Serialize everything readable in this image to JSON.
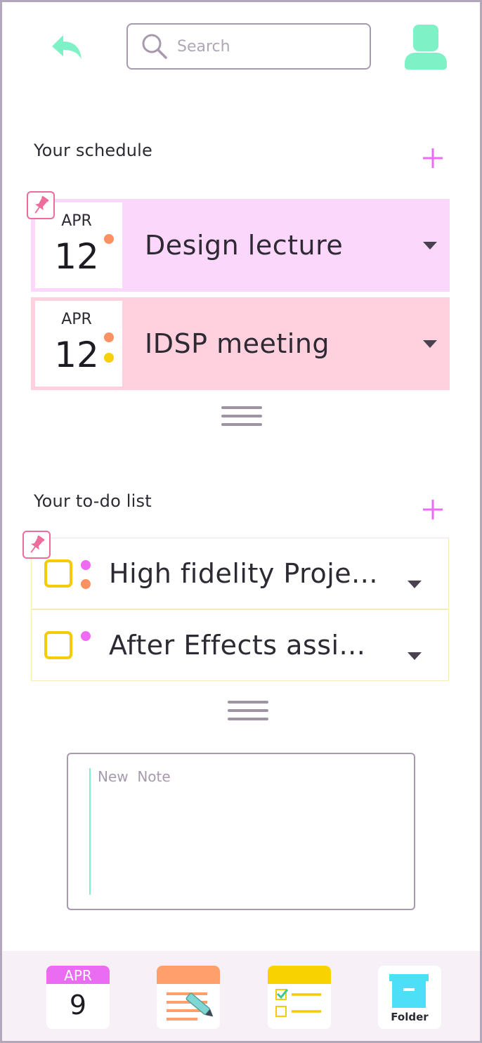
{
  "header": {
    "search_placeholder": "Search"
  },
  "schedule": {
    "title": "Your schedule",
    "items": [
      {
        "month": "APR",
        "day": "12",
        "title": "Design lecture",
        "bg": "#fbd7fb",
        "dots": [
          "#fa9162"
        ]
      },
      {
        "month": "APR",
        "day": "12",
        "title": "IDSP meeting",
        "bg": "#ffd1de",
        "dots": [
          "#fa9162",
          "#f6d10b"
        ]
      }
    ]
  },
  "todo": {
    "title": "Your to-do list",
    "items": [
      {
        "title": "High fidelity Proje...",
        "dots": [
          "#f06bf3",
          "#fa9162"
        ]
      },
      {
        "title": "After Effects assi...",
        "dots": [
          "#f06bf3"
        ]
      }
    ]
  },
  "note": {
    "placeholder": "New  Note"
  },
  "bottom_nav": {
    "calendar_month": "APR",
    "calendar_day": "9",
    "folder_label": "Folder"
  },
  "colors": {
    "accent_green": "#7ef2c6",
    "accent_pink": "#e96cf3",
    "pin": "#ee6c9c",
    "checkbox": "#f4cb08",
    "notes_orange": "#ff9f6b",
    "checklist_yellow": "#f8d301",
    "folder_cyan": "#4ddff8"
  },
  "icons": [
    "back-arrow-icon",
    "search-icon",
    "profile-icon",
    "plus-icon",
    "pin-icon",
    "caret-down-icon",
    "drag-handle-icon",
    "calendar-icon",
    "notes-icon",
    "checklist-icon",
    "folder-icon"
  ]
}
